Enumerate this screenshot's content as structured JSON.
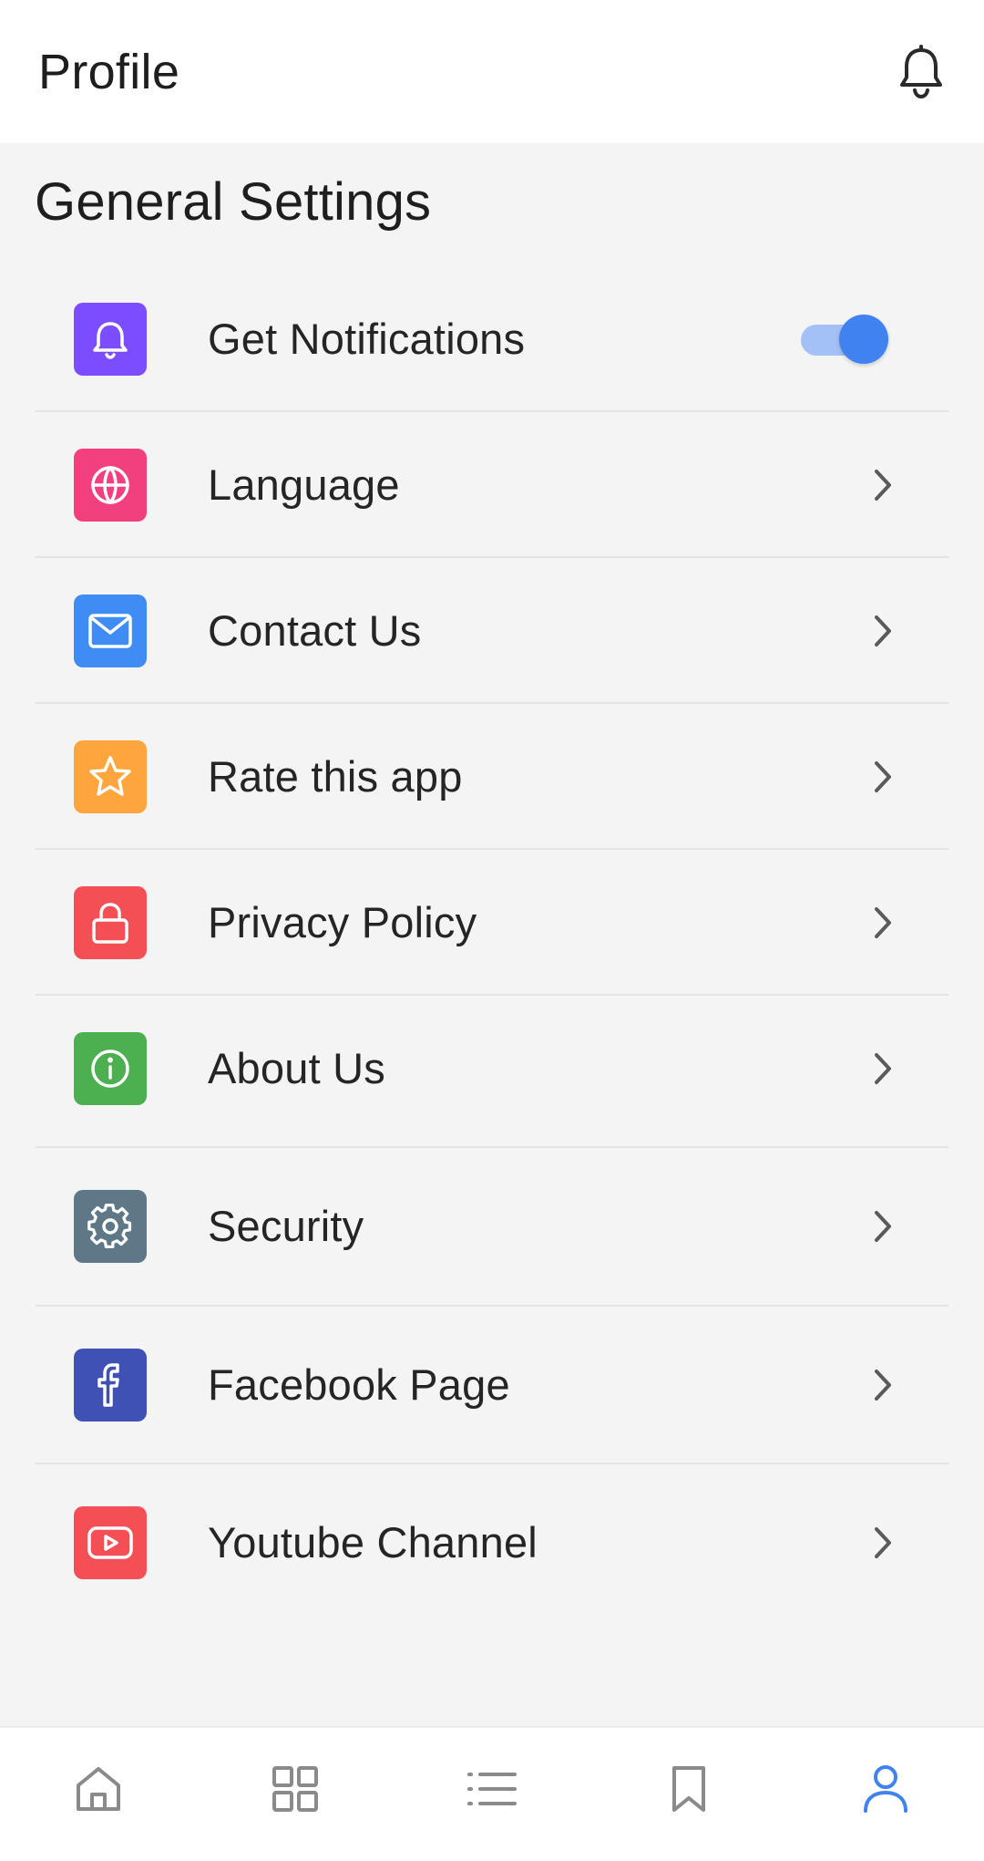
{
  "header": {
    "title": "Profile",
    "bell_icon": "bell-icon"
  },
  "section": {
    "title": "General Settings"
  },
  "settings": [
    {
      "key": "notifications",
      "label": "Get Notifications",
      "icon": "bell-icon",
      "color": "#7c4dff",
      "control": "toggle",
      "enabled": true
    },
    {
      "key": "language",
      "label": "Language",
      "icon": "globe-icon",
      "color": "#f2407f",
      "control": "chevron"
    },
    {
      "key": "contact",
      "label": "Contact Us",
      "icon": "mail-icon",
      "color": "#3f8cf4",
      "control": "chevron"
    },
    {
      "key": "rate",
      "label": "Rate this app",
      "icon": "star-icon",
      "color": "#ffa53d",
      "control": "chevron"
    },
    {
      "key": "privacy",
      "label": "Privacy Policy",
      "icon": "lock-icon",
      "color": "#f44f54",
      "control": "chevron"
    },
    {
      "key": "about",
      "label": "About Us",
      "icon": "info-icon",
      "color": "#4caf50",
      "control": "chevron"
    },
    {
      "key": "security",
      "label": "Security",
      "icon": "gear-icon",
      "color": "#5e7887",
      "control": "chevron"
    },
    {
      "key": "facebook",
      "label": "Facebook Page",
      "icon": "facebook-icon",
      "color": "#3f51b5",
      "control": "chevron"
    },
    {
      "key": "youtube",
      "label": "Youtube Channel",
      "icon": "youtube-icon",
      "color": "#f44f54",
      "control": "chevron"
    }
  ],
  "bottom_nav": {
    "items": [
      {
        "key": "home",
        "icon": "home-icon",
        "active": false
      },
      {
        "key": "categories",
        "icon": "grid-icon",
        "active": false
      },
      {
        "key": "list",
        "icon": "list-icon",
        "active": false
      },
      {
        "key": "bookmarks",
        "icon": "bookmark-icon",
        "active": false
      },
      {
        "key": "profile",
        "icon": "user-icon",
        "active": true
      }
    ],
    "active_color": "#3f82f0",
    "inactive_color": "#8a8a8a"
  }
}
